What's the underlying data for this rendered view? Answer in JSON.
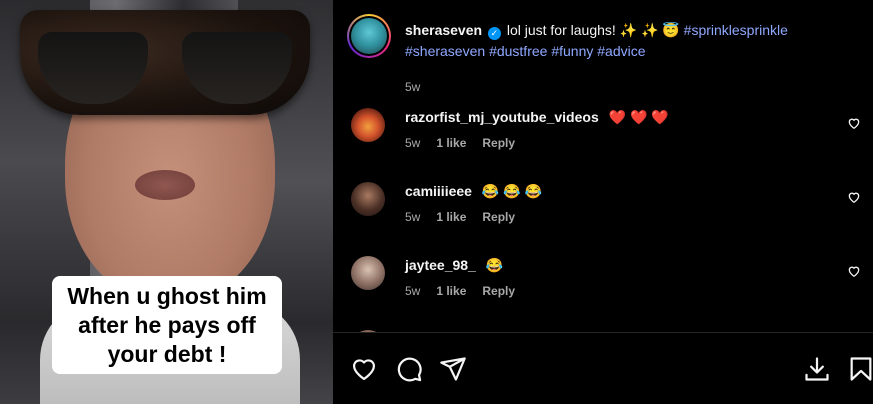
{
  "media": {
    "caption": "When u ghost him\nafter he pays off\nyour debt !"
  },
  "post": {
    "username": "sheraseven",
    "verified_icon": "verified-badge-icon",
    "text": "lol just for laughs! ✨ ✨ 😇",
    "hashtags": [
      "#sprinklesprinkle",
      "#sheraseven",
      "#dustfree",
      "#funny",
      "#advice"
    ],
    "time": "5w"
  },
  "comments": [
    {
      "username": "razorfist_mj_youtube_videos",
      "text": "❤️ ❤️ ❤️",
      "time": "5w",
      "likes": "1 like",
      "reply": "Reply"
    },
    {
      "username": "camiiiieee",
      "text": "😂 😂 😂",
      "time": "5w",
      "likes": "1 like",
      "reply": "Reply"
    },
    {
      "username": "jaytee_98_",
      "text": "😂",
      "time": "5w",
      "likes": "1 like",
      "reply": "Reply"
    }
  ],
  "actions": {
    "like_icon": "heart-icon",
    "comment_icon": "comment-icon",
    "share_icon": "share-icon",
    "download_icon": "download-icon",
    "save_icon": "bookmark-icon"
  },
  "colors": {
    "background": "#000000",
    "hashtag": "#8fa8ff",
    "verified": "#0095f6",
    "heart_red": "#ff3040",
    "secondary_text": "#a8a8a8"
  }
}
